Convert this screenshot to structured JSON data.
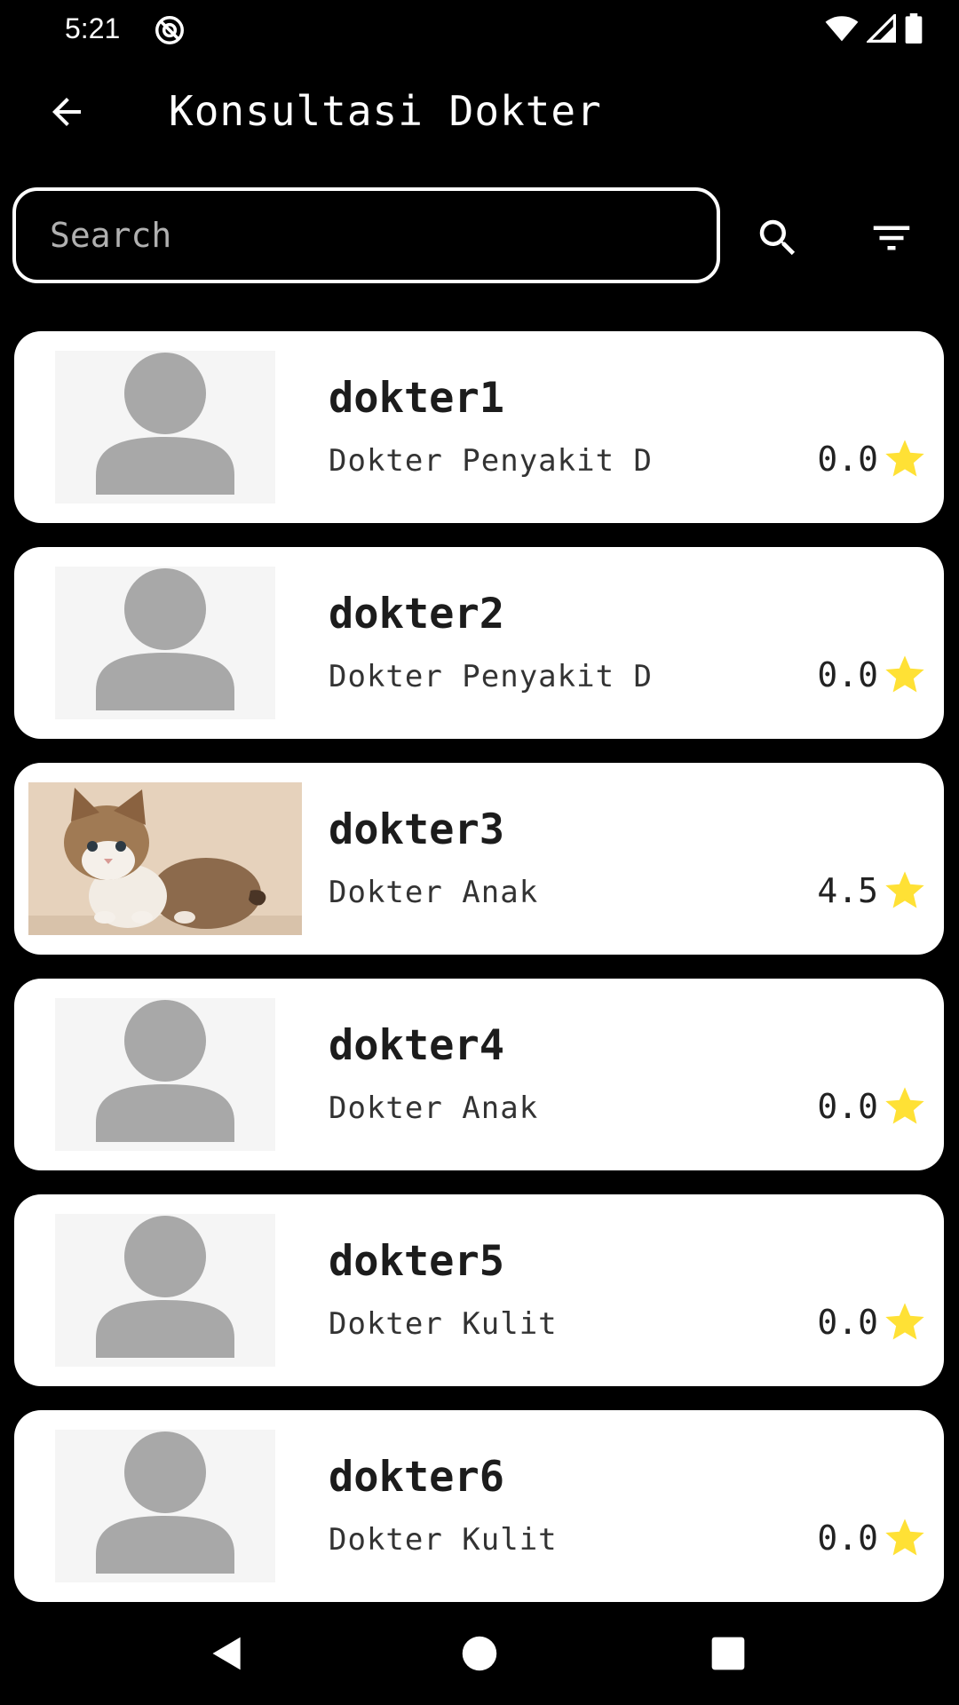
{
  "status_bar": {
    "time": "5:21"
  },
  "app_bar": {
    "title": "Konsultasi Dokter"
  },
  "search": {
    "value": "",
    "placeholder": "Search"
  },
  "colors": {
    "background": "#000000",
    "card": "#ffffff",
    "star": "#FFE135",
    "avatar_placeholder": "#a8a8a8"
  },
  "doctors": [
    {
      "name": "dokter1",
      "specialty": "Dokter Penyakit D",
      "rating": "0.0",
      "avatar": "person-placeholder-icon"
    },
    {
      "name": "dokter2",
      "specialty": "Dokter Penyakit D",
      "rating": "0.0",
      "avatar": "person-placeholder-icon"
    },
    {
      "name": "dokter3",
      "specialty": "Dokter Anak",
      "rating": "4.5",
      "avatar": "kitten-photo"
    },
    {
      "name": "dokter4",
      "specialty": "Dokter Anak",
      "rating": "0.0",
      "avatar": "person-placeholder-icon"
    },
    {
      "name": "dokter5",
      "specialty": "Dokter Kulit",
      "rating": "0.0",
      "avatar": "person-placeholder-icon"
    },
    {
      "name": "dokter6",
      "specialty": "Dokter Kulit",
      "rating": "0.0",
      "avatar": "person-placeholder-icon"
    }
  ],
  "icons": {
    "back": "arrow-back-icon",
    "search": "search-icon",
    "filter": "filter-icon",
    "rating": "star-icon",
    "nav_back": "nav-back-icon",
    "nav_home": "nav-home-icon",
    "nav_recents": "nav-recents-icon"
  }
}
